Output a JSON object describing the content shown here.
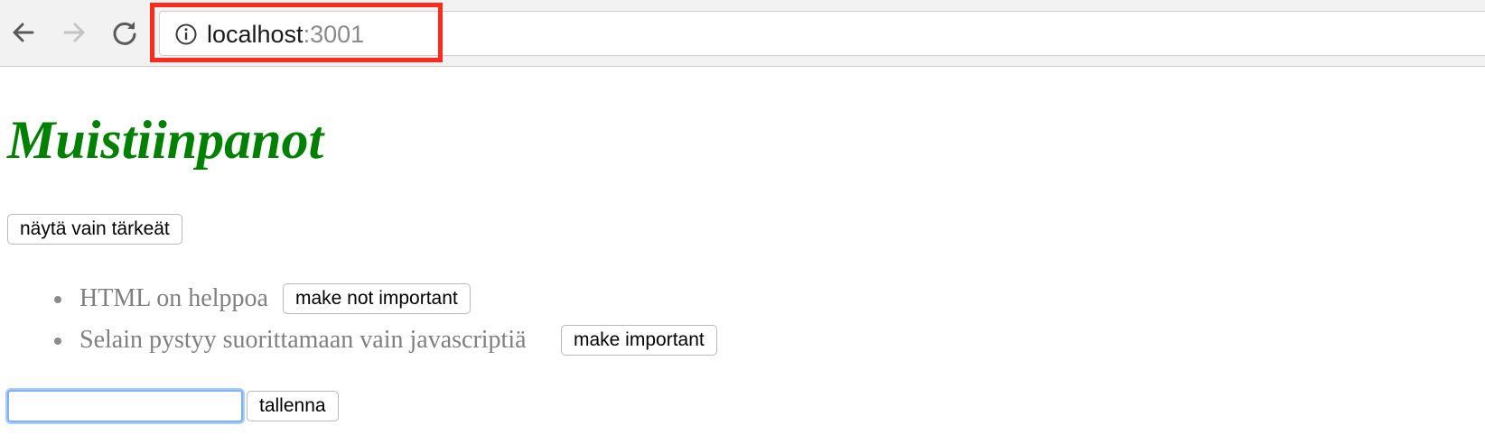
{
  "browser": {
    "url_host": "localhost",
    "url_port": ":3001",
    "icons": {
      "back": "arrow-left-icon",
      "forward": "arrow-right-icon",
      "reload": "reload-icon",
      "info": "info-circle-icon"
    },
    "highlight_color": "#ff2a1a"
  },
  "page": {
    "title": "Muistiinpanot",
    "title_color": "#008000",
    "filter_button_label": "näytä vain tärkeät",
    "notes": [
      {
        "text": "HTML on helppoa",
        "button_label": "make not important"
      },
      {
        "text": "Selain pystyy suorittamaan vain javascriptiä",
        "button_label": "make important"
      }
    ],
    "new_note_input_value": "",
    "save_button_label": "tallenna"
  }
}
